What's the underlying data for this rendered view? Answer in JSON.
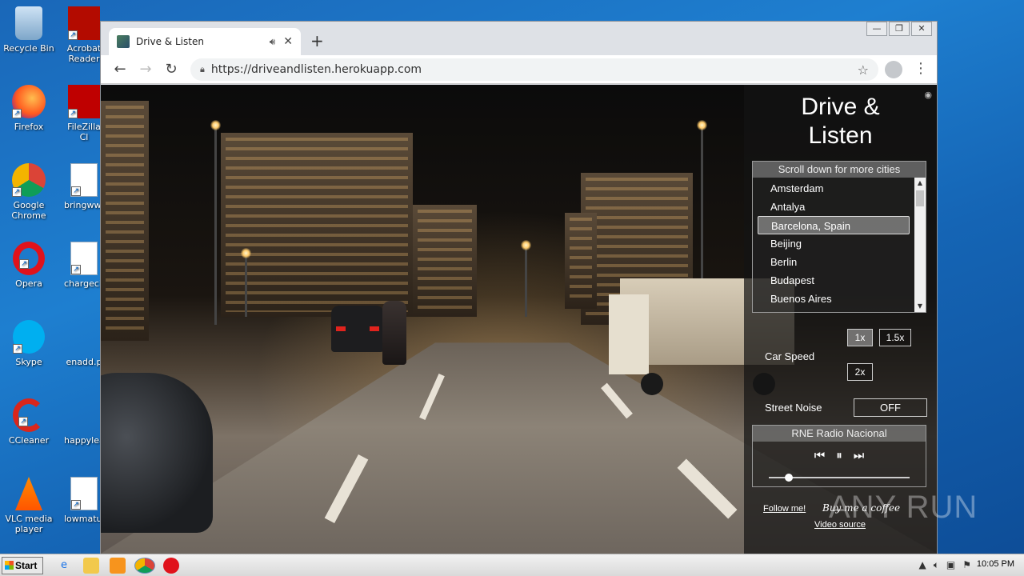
{
  "desktop": {
    "icons": [
      {
        "label": "Recycle Bin",
        "icon": "recycle-bin-icon"
      },
      {
        "label": "Acrobat Reader",
        "icon": "acrobat-icon"
      },
      {
        "label": "Firefox",
        "icon": "firefox-icon"
      },
      {
        "label": "FileZilla Cl",
        "icon": "filezilla-icon"
      },
      {
        "label": "Google Chrome",
        "icon": "chrome-icon"
      },
      {
        "label": "bringwww",
        "icon": "word-doc-icon"
      },
      {
        "label": "Opera",
        "icon": "opera-icon"
      },
      {
        "label": "chargeciv",
        "icon": "word-doc-icon"
      },
      {
        "label": "Skype",
        "icon": "skype-icon"
      },
      {
        "label": "enadd.p",
        "icon": "file-icon"
      },
      {
        "label": "CCleaner",
        "icon": "ccleaner-icon"
      },
      {
        "label": "happylea",
        "icon": "file-icon"
      },
      {
        "label": "VLC media player",
        "icon": "vlc-icon"
      },
      {
        "label": "lowmatur",
        "icon": "word-doc-icon"
      }
    ]
  },
  "browser": {
    "tab_title": "Drive & Listen",
    "url": "https://driveandlisten.herokuapp.com",
    "new_tab_symbol": "+",
    "controls": {
      "minimize": "—",
      "restore": "❐",
      "close": "✕"
    }
  },
  "app": {
    "title_line1": "Drive &",
    "title_line2": "Listen",
    "city_header": "Scroll down for more cities",
    "cities": [
      "Amsterdam",
      "Antalya",
      "Barcelona, Spain",
      "Beijing",
      "Berlin",
      "Budapest",
      "Buenos Aires"
    ],
    "selected_city": "Barcelona, Spain",
    "speed_label": "Car Speed",
    "speeds": [
      "1x",
      "1.5x",
      "2x"
    ],
    "active_speed": "1x",
    "noise_label": "Street Noise",
    "noise_value": "OFF",
    "radio_station": "RNE Radio Nacional",
    "radio_progress": 0.14,
    "follow_label": "Follow me!",
    "coffee_label": "Buy me a coffee",
    "source_label": "Video source"
  },
  "watermark": "ANY RUN",
  "taskbar": {
    "start_label": "Start",
    "clock": "10:05 PM"
  }
}
